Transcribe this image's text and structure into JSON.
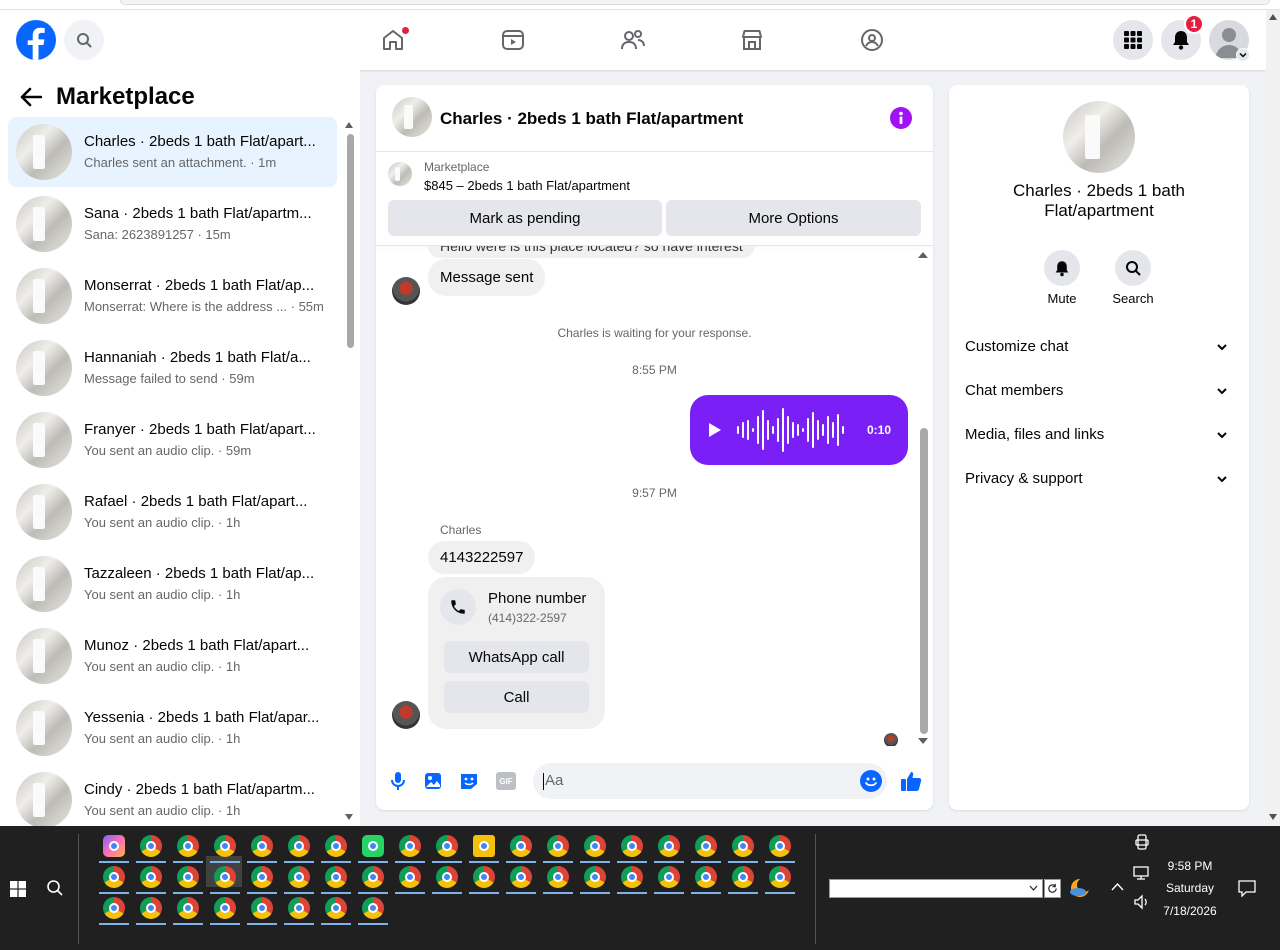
{
  "nav": {
    "notifications_count": "1"
  },
  "left_panel": {
    "title": "Marketplace",
    "conversations": [
      {
        "title": "Charles · 2beds 1 bath Flat/apart...",
        "subtitle": "Charles sent an attachment. · 1m",
        "active": true
      },
      {
        "title": "Sana · 2beds 1 bath Flat/apartm...",
        "subtitle": "Sana: 2623891257 · 15m"
      },
      {
        "title": "Monserrat · 2beds 1 bath Flat/ap...",
        "subtitle": "Monserrat: Where is the address ... · 55m"
      },
      {
        "title": "Hannaniah · 2beds 1 bath Flat/a...",
        "subtitle": "Message failed to send · 59m"
      },
      {
        "title": "Franyer · 2beds 1 bath Flat/apart...",
        "subtitle": "You sent an audio clip. · 59m"
      },
      {
        "title": "Rafael · 2beds 1 bath Flat/apart...",
        "subtitle": "You sent an audio clip. · 1h"
      },
      {
        "title": "Tazzaleen · 2beds 1 bath Flat/ap...",
        "subtitle": "You sent an audio clip. · 1h"
      },
      {
        "title": "Munoz · 2beds 1 bath Flat/apart...",
        "subtitle": "You sent an audio clip. · 1h"
      },
      {
        "title": "Yessenia · 2beds 1 bath Flat/apar...",
        "subtitle": "You sent an audio clip. · 1h"
      },
      {
        "title": "Cindy · 2beds 1 bath Flat/apartm...",
        "subtitle": "You sent an audio clip. · 1h"
      }
    ]
  },
  "chat": {
    "header_title": "Charles · 2beds 1 bath Flat/apartment",
    "listing_source": "Marketplace",
    "listing_text": "$845 – 2beds 1 bath Flat/apartment",
    "mark_pending": "Mark as pending",
    "more_options": "More Options",
    "partial_message": "Hello were is this place located? so have interest",
    "message_sent": "Message sent",
    "waiting_notice": "Charles is waiting for your response.",
    "time_1": "8:55 PM",
    "audio_duration": "0:10",
    "time_2": "9:57 PM",
    "sender_name": "Charles",
    "phone_message": "4143222597",
    "phone_card_title": "Phone number",
    "phone_card_number": "(414)322-2597",
    "whatsapp_call": "WhatsApp call",
    "call": "Call",
    "composer_placeholder": "Aa"
  },
  "right_panel": {
    "title": "Charles · 2beds 1 bath Flat/apartment",
    "mute_label": "Mute",
    "search_label": "Search",
    "sections": [
      "Customize chat",
      "Chat members",
      "Media, files and links",
      "Privacy & support"
    ]
  },
  "taskbar": {
    "time": "9:58 PM",
    "day": "Saturday",
    "date": "7/18/2026"
  },
  "colors": {
    "facebook_blue": "#0866ff",
    "audio_bubble": "#7a1ff5",
    "info_purple": "#a012f5",
    "notification_red": "#e41e3f"
  }
}
